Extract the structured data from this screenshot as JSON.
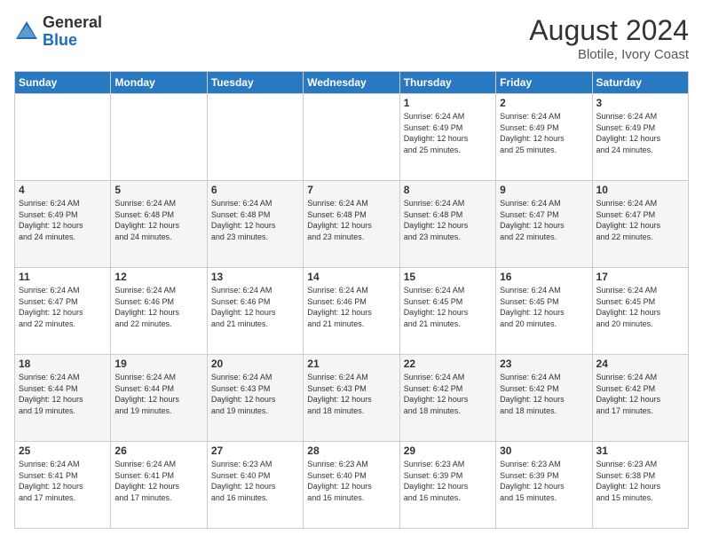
{
  "header": {
    "logo_general": "General",
    "logo_blue": "Blue",
    "month_year": "August 2024",
    "location": "Blotile, Ivory Coast"
  },
  "days_of_week": [
    "Sunday",
    "Monday",
    "Tuesday",
    "Wednesday",
    "Thursday",
    "Friday",
    "Saturday"
  ],
  "weeks": [
    [
      {
        "day": "",
        "info": ""
      },
      {
        "day": "",
        "info": ""
      },
      {
        "day": "",
        "info": ""
      },
      {
        "day": "",
        "info": ""
      },
      {
        "day": "1",
        "info": "Sunrise: 6:24 AM\nSunset: 6:49 PM\nDaylight: 12 hours\nand 25 minutes."
      },
      {
        "day": "2",
        "info": "Sunrise: 6:24 AM\nSunset: 6:49 PM\nDaylight: 12 hours\nand 25 minutes."
      },
      {
        "day": "3",
        "info": "Sunrise: 6:24 AM\nSunset: 6:49 PM\nDaylight: 12 hours\nand 24 minutes."
      }
    ],
    [
      {
        "day": "4",
        "info": "Sunrise: 6:24 AM\nSunset: 6:49 PM\nDaylight: 12 hours\nand 24 minutes."
      },
      {
        "day": "5",
        "info": "Sunrise: 6:24 AM\nSunset: 6:48 PM\nDaylight: 12 hours\nand 24 minutes."
      },
      {
        "day": "6",
        "info": "Sunrise: 6:24 AM\nSunset: 6:48 PM\nDaylight: 12 hours\nand 23 minutes."
      },
      {
        "day": "7",
        "info": "Sunrise: 6:24 AM\nSunset: 6:48 PM\nDaylight: 12 hours\nand 23 minutes."
      },
      {
        "day": "8",
        "info": "Sunrise: 6:24 AM\nSunset: 6:48 PM\nDaylight: 12 hours\nand 23 minutes."
      },
      {
        "day": "9",
        "info": "Sunrise: 6:24 AM\nSunset: 6:47 PM\nDaylight: 12 hours\nand 22 minutes."
      },
      {
        "day": "10",
        "info": "Sunrise: 6:24 AM\nSunset: 6:47 PM\nDaylight: 12 hours\nand 22 minutes."
      }
    ],
    [
      {
        "day": "11",
        "info": "Sunrise: 6:24 AM\nSunset: 6:47 PM\nDaylight: 12 hours\nand 22 minutes."
      },
      {
        "day": "12",
        "info": "Sunrise: 6:24 AM\nSunset: 6:46 PM\nDaylight: 12 hours\nand 22 minutes."
      },
      {
        "day": "13",
        "info": "Sunrise: 6:24 AM\nSunset: 6:46 PM\nDaylight: 12 hours\nand 21 minutes."
      },
      {
        "day": "14",
        "info": "Sunrise: 6:24 AM\nSunset: 6:46 PM\nDaylight: 12 hours\nand 21 minutes."
      },
      {
        "day": "15",
        "info": "Sunrise: 6:24 AM\nSunset: 6:45 PM\nDaylight: 12 hours\nand 21 minutes."
      },
      {
        "day": "16",
        "info": "Sunrise: 6:24 AM\nSunset: 6:45 PM\nDaylight: 12 hours\nand 20 minutes."
      },
      {
        "day": "17",
        "info": "Sunrise: 6:24 AM\nSunset: 6:45 PM\nDaylight: 12 hours\nand 20 minutes."
      }
    ],
    [
      {
        "day": "18",
        "info": "Sunrise: 6:24 AM\nSunset: 6:44 PM\nDaylight: 12 hours\nand 19 minutes."
      },
      {
        "day": "19",
        "info": "Sunrise: 6:24 AM\nSunset: 6:44 PM\nDaylight: 12 hours\nand 19 minutes."
      },
      {
        "day": "20",
        "info": "Sunrise: 6:24 AM\nSunset: 6:43 PM\nDaylight: 12 hours\nand 19 minutes."
      },
      {
        "day": "21",
        "info": "Sunrise: 6:24 AM\nSunset: 6:43 PM\nDaylight: 12 hours\nand 18 minutes."
      },
      {
        "day": "22",
        "info": "Sunrise: 6:24 AM\nSunset: 6:42 PM\nDaylight: 12 hours\nand 18 minutes."
      },
      {
        "day": "23",
        "info": "Sunrise: 6:24 AM\nSunset: 6:42 PM\nDaylight: 12 hours\nand 18 minutes."
      },
      {
        "day": "24",
        "info": "Sunrise: 6:24 AM\nSunset: 6:42 PM\nDaylight: 12 hours\nand 17 minutes."
      }
    ],
    [
      {
        "day": "25",
        "info": "Sunrise: 6:24 AM\nSunset: 6:41 PM\nDaylight: 12 hours\nand 17 minutes."
      },
      {
        "day": "26",
        "info": "Sunrise: 6:24 AM\nSunset: 6:41 PM\nDaylight: 12 hours\nand 17 minutes."
      },
      {
        "day": "27",
        "info": "Sunrise: 6:23 AM\nSunset: 6:40 PM\nDaylight: 12 hours\nand 16 minutes."
      },
      {
        "day": "28",
        "info": "Sunrise: 6:23 AM\nSunset: 6:40 PM\nDaylight: 12 hours\nand 16 minutes."
      },
      {
        "day": "29",
        "info": "Sunrise: 6:23 AM\nSunset: 6:39 PM\nDaylight: 12 hours\nand 16 minutes."
      },
      {
        "day": "30",
        "info": "Sunrise: 6:23 AM\nSunset: 6:39 PM\nDaylight: 12 hours\nand 15 minutes."
      },
      {
        "day": "31",
        "info": "Sunrise: 6:23 AM\nSunset: 6:38 PM\nDaylight: 12 hours\nand 15 minutes."
      }
    ]
  ]
}
